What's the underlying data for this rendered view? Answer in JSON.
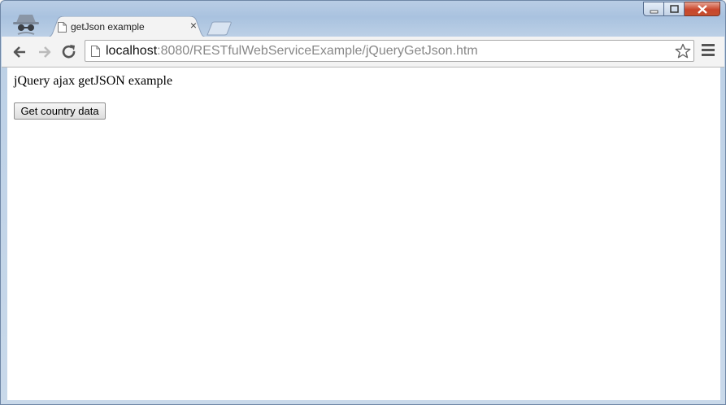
{
  "window": {
    "tab": {
      "title": "getJson example",
      "close_glyph": "×"
    },
    "new_tab_icon": "new-tab-icon"
  },
  "toolbar": {
    "url_host": "localhost",
    "url_rest": ":8080/RESTfulWebServiceExample/jQueryGetJson.htm",
    "icons": [
      "back-arrow-icon",
      "forward-arrow-icon",
      "reload-icon",
      "page-icon",
      "bookmark-star-icon",
      "chrome-menu-icon"
    ]
  },
  "page": {
    "heading": "jQuery ajax getJSON example",
    "button_label": "Get country data"
  },
  "colors": {
    "frame": "#b9cde5",
    "close_button": "#c9462c",
    "toolbar": "#f3f3f3"
  }
}
